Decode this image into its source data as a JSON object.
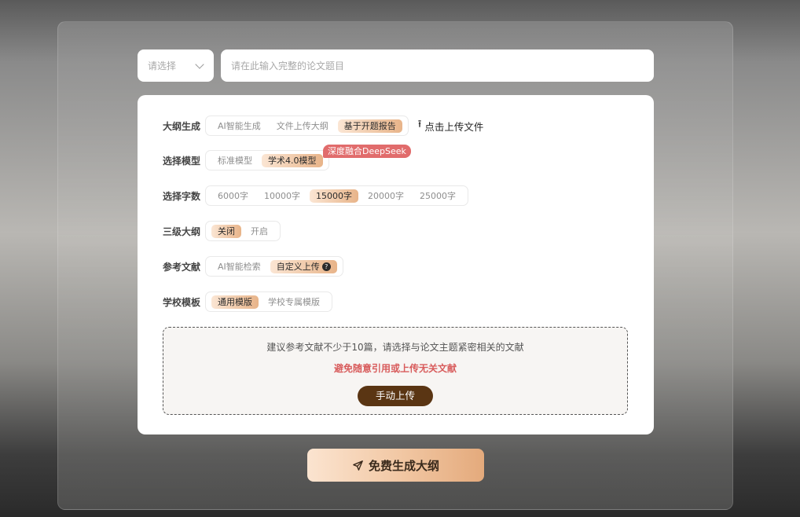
{
  "topbar": {
    "select_value": "请选择",
    "title_placeholder": "请在此输入完整的论文题目"
  },
  "rows": {
    "outline": {
      "label": "大纲生成",
      "options": [
        "AI智能生成",
        "文件上传大纲",
        "基于开题报告"
      ],
      "selected": "基于开题报告",
      "upload_label": "点击上传文件"
    },
    "model": {
      "label": "选择模型",
      "options": [
        "标准模型",
        "学术4.0模型"
      ],
      "selected": "学术4.0模型",
      "badge": "深度融合DeepSeek"
    },
    "wordcount": {
      "label": "选择字数",
      "options": [
        "6000字",
        "10000字",
        "15000字",
        "20000字",
        "25000字"
      ],
      "selected": "15000字"
    },
    "level3": {
      "label": "三级大纲",
      "options": [
        "关闭",
        "开启"
      ],
      "selected": "关闭"
    },
    "references": {
      "label": "参考文献",
      "options": [
        "AI智能检索",
        "自定义上传"
      ],
      "selected": "自定义上传",
      "help_icon": "?"
    },
    "template": {
      "label": "学校模板",
      "options": [
        "通用模版",
        "学校专属模版"
      ],
      "selected": "通用模版"
    }
  },
  "dropzone": {
    "hint": "建议参考文献不少于10篇，请选择与论文主题紧密相关的文献",
    "warning": "避免随意引用或上传无关文献",
    "button_label": "手动上传"
  },
  "generate_button": {
    "label": "免费生成大纲",
    "icon": "send-icon"
  },
  "colors": {
    "accent_gradient_start": "#fbe6d4",
    "accent_gradient_end": "#e8b489",
    "badge": "#e16c6c",
    "manual_button": "#5a3513",
    "warning_text": "#d85c5c"
  }
}
